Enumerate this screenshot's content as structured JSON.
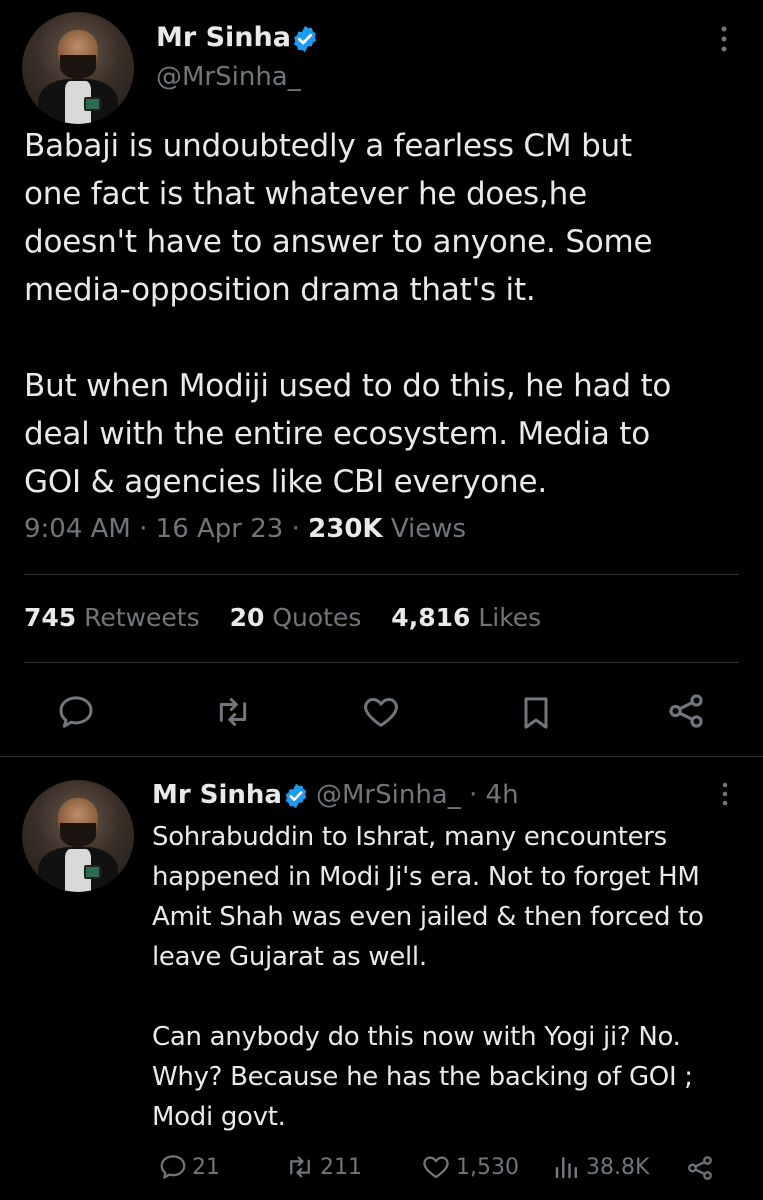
{
  "tweet": {
    "author_name": "Mr Sinha",
    "author_handle": "@MrSinha_",
    "text": "Babaji is undoubtedly a fearless CM but\none fact is that whatever he does,he\ndoesn't have to answer to anyone. Some\nmedia-opposition drama that's it.\n\nBut when Modiji used to do this, he had to\ndeal with the entire ecosystem. Media to\nGOI & agencies like CBI everyone.",
    "time": "9:04 AM",
    "sep1": "·",
    "date": "16 Apr 23",
    "sep2": "·",
    "views_count": "230K",
    "views_label": "Views",
    "retweets_count": "745",
    "retweets_label": "Retweets",
    "quotes_count": "20",
    "quotes_label": "Quotes",
    "likes_count": "4,816",
    "likes_label": "Likes"
  },
  "reply": {
    "author_name": "Mr Sinha",
    "author_handle": "@MrSinha_",
    "age": "· 4h",
    "text": "Sohrabuddin to Ishrat, many encounters\nhappened in Modi Ji's era. Not to forget HM\nAmit Shah was even jailed & then forced to\nleave Gujarat as well.\n\nCan anybody do this now with Yogi ji? No.\nWhy? Because he has the backing of GOI ;\nModi govt.",
    "replies": "21",
    "retweets": "211",
    "likes": "1,530",
    "views": "38.8K"
  },
  "colors": {
    "background": "#000000",
    "text": "#e7e9ea",
    "muted": "#71767b",
    "verified": "#1d9bf0",
    "divider": "#2f3336"
  },
  "icons": {
    "main_actions": [
      "reply-icon",
      "retweet-icon",
      "like-icon",
      "bookmark-icon",
      "share-icon"
    ],
    "reply_actions": [
      "reply-icon",
      "retweet-icon",
      "like-icon",
      "views-icon",
      "share-icon"
    ]
  }
}
